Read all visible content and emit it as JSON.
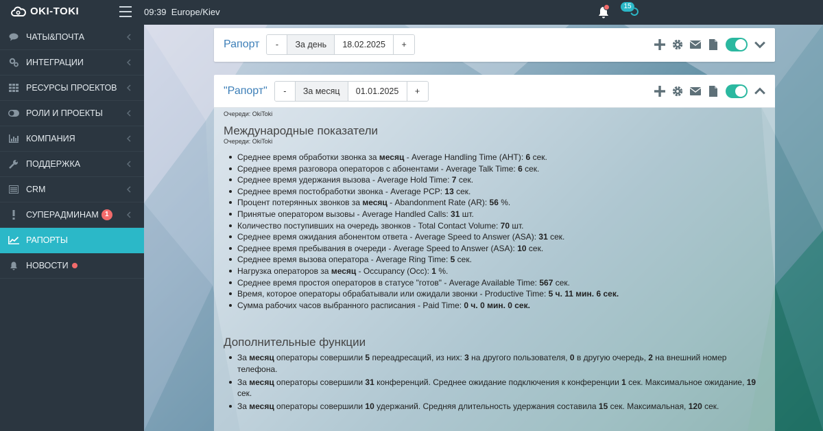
{
  "app": {
    "logo": "OKI-TOKI",
    "time": "09:39",
    "timezone": "Europe/Kiev",
    "notifications_count": "15"
  },
  "colors": {
    "sidebar": "#2b3640",
    "accent": "#2bb8c8",
    "badge": "#f26b6b",
    "title_link": "#3d7fb8",
    "toggle": "#2bb8a0"
  },
  "sidebar": {
    "items": [
      {
        "label": "ЧАТЫ&ПОЧТА",
        "icon": "chat-icon"
      },
      {
        "label": "ИНТЕГРАЦИИ",
        "icon": "gears-icon"
      },
      {
        "label": "РЕСУРСЫ ПРОЕКТОВ",
        "icon": "grid-icon"
      },
      {
        "label": "РОЛИ И ПРОЕКТЫ",
        "icon": "toggle-icon"
      },
      {
        "label": "КОМПАНИЯ",
        "icon": "bar-chart-icon"
      },
      {
        "label": "ПОДДЕРЖКА",
        "icon": "wrench-icon"
      },
      {
        "label": "CRM",
        "icon": "list-icon"
      },
      {
        "label": "СУПЕРАДМИНАМ",
        "icon": "exclamation-icon",
        "badge": "1"
      },
      {
        "label": "РАПОРТЫ",
        "icon": "line-chart-icon",
        "active": true
      },
      {
        "label": "НОВОСТИ",
        "icon": "bell-icon",
        "dot": true
      }
    ]
  },
  "panel1": {
    "title": "Рапорт",
    "minus": "-",
    "period": "За день",
    "date": "18.02.2025",
    "plus": "+"
  },
  "panel2": {
    "title": "\"Рапорт\"",
    "minus": "-",
    "period": "За месяц",
    "date": "01.01.2025",
    "plus": "+",
    "queues": "Очереди: OkiToki",
    "section1_title": "Международные показатели",
    "section1_queues": "Очереди: OkiToki",
    "metrics": [
      {
        "pre": "Среднее время обработки звонка за ",
        "em": "месяц",
        "mid": " - Average Handling Time (AHT): ",
        "val": "6",
        "post": " сек."
      },
      {
        "pre": "Среднее время разговора операторов с абонентами - Average Talk Time: ",
        "em": "",
        "mid": "",
        "val": "6",
        "post": " сек."
      },
      {
        "pre": "Среднее время удержания вызова - Average Hold Time: ",
        "em": "",
        "mid": "",
        "val": "7",
        "post": " сек."
      },
      {
        "pre": "Среднее время постобработки звонка - Average PCP: ",
        "em": "",
        "mid": "",
        "val": "13",
        "post": " сек."
      },
      {
        "pre": "Процент потерянных звонков за ",
        "em": "месяц",
        "mid": " - Abandonment Rate (AR): ",
        "val": "56",
        "post": " %."
      },
      {
        "pre": "Принятые оператором вызовы - Average Handled Calls: ",
        "em": "",
        "mid": "",
        "val": "31",
        "post": " шт."
      },
      {
        "pre": "Количество поступивших на очередь звонков - Total Contact Volume: ",
        "em": "",
        "mid": "",
        "val": "70",
        "post": " шт."
      },
      {
        "pre": "Среднее время ожидания абонентом ответа - Average Speed to Answer (ASA): ",
        "em": "",
        "mid": "",
        "val": "31",
        "post": " сек."
      },
      {
        "pre": "Среднее время пребывания в очереди - Average Speed to Answer (ASA): ",
        "em": "",
        "mid": "",
        "val": "10",
        "post": " сек."
      },
      {
        "pre": "Среднее время вызова оператора - Average Ring Time: ",
        "em": "",
        "mid": "",
        "val": "5",
        "post": " сек."
      },
      {
        "pre": "Нагрузка операторов за ",
        "em": "месяц",
        "mid": " - Occupancy (Occ): ",
        "val": "1",
        "post": " %."
      },
      {
        "pre": "Среднее время простоя операторов в статусе \"готов\" - Average Available Time: ",
        "em": "",
        "mid": "",
        "val": "567",
        "post": " сек."
      },
      {
        "pre": "Время, которое операторы обрабатывали или ожидали звонки - Productive Time: ",
        "em": "",
        "mid": "",
        "val": "5 ч. 11 мин. 6 сек.",
        "post": ""
      },
      {
        "pre": "Сумма рабочих часов выбранного расписания - Paid Time: ",
        "em": "",
        "mid": "",
        "val": "0 ч. 0 мин. 0 сек.",
        "post": ""
      }
    ],
    "section2_title": "Дополнительные функции",
    "extras": [
      {
        "parts": [
          {
            "t": "За ",
            "b": false
          },
          {
            "t": "месяц",
            "b": true
          },
          {
            "t": " операторы совершили ",
            "b": false
          },
          {
            "t": "5",
            "b": true
          },
          {
            "t": " переадресаций, из них: ",
            "b": false
          },
          {
            "t": "3",
            "b": true
          },
          {
            "t": " на другого пользователя, ",
            "b": false
          },
          {
            "t": "0",
            "b": true
          },
          {
            "t": " в другую очередь, ",
            "b": false
          },
          {
            "t": "2",
            "b": true
          },
          {
            "t": " на внешний номер телефона.",
            "b": false
          }
        ]
      },
      {
        "parts": [
          {
            "t": "За ",
            "b": false
          },
          {
            "t": "месяц",
            "b": true
          },
          {
            "t": " операторы совершили ",
            "b": false
          },
          {
            "t": "31",
            "b": true
          },
          {
            "t": " конференций. Среднее ожидание подключения к конференции ",
            "b": false
          },
          {
            "t": "1",
            "b": true
          },
          {
            "t": " сек. Максимальное ожидание, ",
            "b": false
          },
          {
            "t": "19",
            "b": true
          },
          {
            "t": " сек.",
            "b": false
          }
        ]
      },
      {
        "parts": [
          {
            "t": "За ",
            "b": false
          },
          {
            "t": "месяц",
            "b": true
          },
          {
            "t": " операторы совершили ",
            "b": false
          },
          {
            "t": "10",
            "b": true
          },
          {
            "t": " удержаний. Средняя длительность удержания составила ",
            "b": false
          },
          {
            "t": "15",
            "b": true
          },
          {
            "t": " сек. Максимальная, ",
            "b": false
          },
          {
            "t": "120",
            "b": true
          },
          {
            "t": " сек.",
            "b": false
          }
        ]
      }
    ]
  }
}
